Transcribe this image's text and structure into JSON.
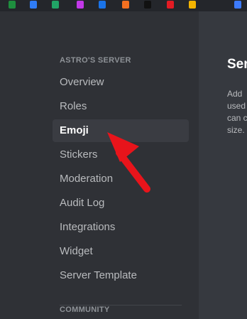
{
  "bookmarks": [
    {
      "icon": "green-sheet-icon",
      "color": "#1e8e3e"
    },
    {
      "icon": "blue-app-icon",
      "color": "#2f7cf6"
    },
    {
      "icon": "green-dollar-icon",
      "color": "#21a366"
    },
    {
      "icon": "purple-app-icon",
      "color": "#c238e8"
    },
    {
      "icon": "blue-check-icon",
      "color": "#1a73e8"
    },
    {
      "icon": "orange-fox-icon",
      "color": "#f37021"
    },
    {
      "icon": "black-square-icon",
      "color": "#111111"
    },
    {
      "icon": "red-circle-icon",
      "color": "#e31b23"
    },
    {
      "icon": "yellow-app-icon",
      "color": "#f5b400"
    },
    {
      "icon": "blue-gem-icon",
      "color": "#3d7bfd"
    }
  ],
  "sidebar": {
    "section_title": "ASTRO'S SERVER",
    "items": [
      {
        "label": "Overview"
      },
      {
        "label": "Roles"
      },
      {
        "label": "Emoji",
        "selected": true
      },
      {
        "label": "Stickers"
      },
      {
        "label": "Moderation"
      },
      {
        "label": "Audit Log"
      },
      {
        "label": "Integrations"
      },
      {
        "label": "Widget"
      },
      {
        "label": "Server Template"
      }
    ],
    "community_title": "COMMUNITY"
  },
  "content": {
    "title": "Ser",
    "description_lines": [
      "Add",
      "used",
      "can c",
      "size."
    ]
  },
  "annotation": {
    "arrow_color": "#e8141b"
  }
}
